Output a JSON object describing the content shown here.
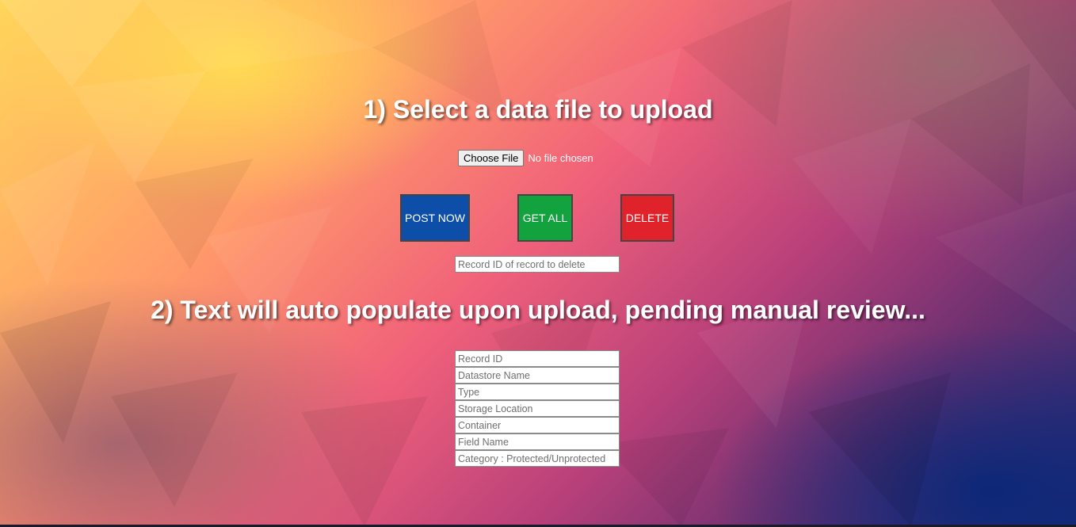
{
  "step1": {
    "heading": "1) Select a data file to upload",
    "choose_file_label": "Choose File",
    "file_status": "No file chosen"
  },
  "actions": {
    "post_label": "POST NOW",
    "get_label": "GET ALL",
    "delete_label": "DELETE",
    "post_color": "#0d4ea8",
    "get_color": "#12a33e",
    "delete_color": "#e0232a"
  },
  "delete_input": {
    "placeholder": "Record ID of record to delete",
    "value": ""
  },
  "step2": {
    "heading": "2) Text will auto populate upon upload, pending manual review..."
  },
  "fields": [
    {
      "placeholder": "Record ID",
      "value": ""
    },
    {
      "placeholder": "Datastore Name",
      "value": ""
    },
    {
      "placeholder": "Type",
      "value": ""
    },
    {
      "placeholder": "Storage Location",
      "value": ""
    },
    {
      "placeholder": "Container",
      "value": ""
    },
    {
      "placeholder": "Field Name",
      "value": ""
    },
    {
      "placeholder": "Category : Protected/Unprotected",
      "value": ""
    }
  ]
}
